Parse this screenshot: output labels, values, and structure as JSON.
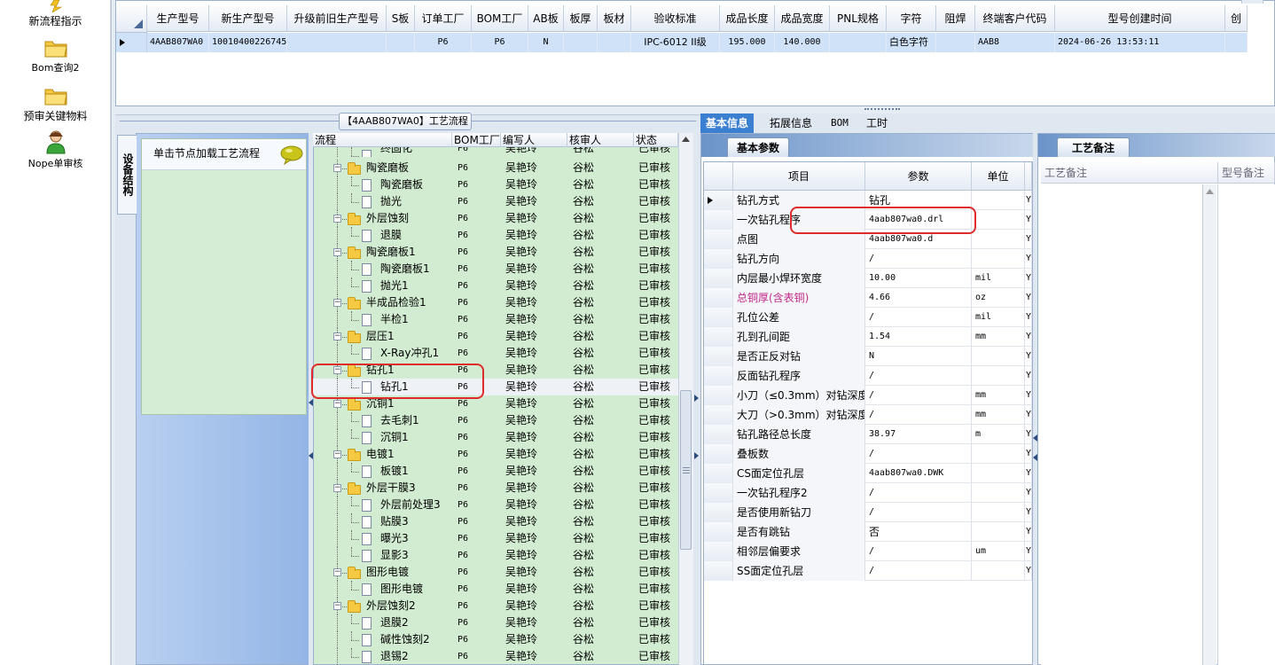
{
  "left_nav": {
    "items": [
      {
        "label": "新流程指示",
        "icon": "lightning-icon"
      },
      {
        "label": "Bom查询2",
        "icon": "folder-icon"
      },
      {
        "label": "预审关键物料",
        "icon": "folder-icon"
      },
      {
        "label": "Nope单审核",
        "icon": "user-icon"
      }
    ]
  },
  "top_grid": {
    "columns": [
      "生产型号",
      "新生产型号",
      "升级前旧生产型号",
      "S板",
      "订单工厂",
      "BOM工厂",
      "AB板",
      "板厚",
      "板材",
      "验收标准",
      "成品长度",
      "成品宽度",
      "PNL规格",
      "字符",
      "阻焊",
      "终端客户代码",
      "型号创建时间",
      "创"
    ],
    "row": [
      "4AAB807WA0",
      "10010400226745",
      "",
      "",
      "P6",
      "P6",
      "N",
      "",
      "",
      "IPC-6012 II级",
      "195.000",
      "140.000",
      "",
      "白色字符",
      "",
      "AAB8",
      "2024-06-26 13:53:11",
      ""
    ]
  },
  "flow": {
    "title": "【4AAB807WA0】工艺流程",
    "equipment_tab": "设备结构",
    "equipment_hint": "单击节点加载工艺流程",
    "tree_columns": [
      "流程",
      "BOM工厂",
      "编写人",
      "核审人",
      "状态"
    ],
    "tree_rows": [
      {
        "name": "终固化",
        "level": 2,
        "type": "doc",
        "bom": "P6",
        "writer": "吴艳玲",
        "reviewer": "谷松",
        "status": "已审核"
      },
      {
        "name": "陶瓷磨板",
        "level": 1,
        "type": "folder",
        "bom": "P6",
        "writer": "吴艳玲",
        "reviewer": "谷松",
        "status": "已审核"
      },
      {
        "name": "陶瓷磨板",
        "level": 2,
        "type": "doc",
        "bom": "P6",
        "writer": "吴艳玲",
        "reviewer": "谷松",
        "status": "已审核"
      },
      {
        "name": "抛光",
        "level": 2,
        "type": "doc",
        "bom": "P6",
        "writer": "吴艳玲",
        "reviewer": "谷松",
        "status": "已审核"
      },
      {
        "name": "外层蚀刻",
        "level": 1,
        "type": "folder",
        "bom": "P6",
        "writer": "吴艳玲",
        "reviewer": "谷松",
        "status": "已审核"
      },
      {
        "name": "退膜",
        "level": 2,
        "type": "doc",
        "bom": "P6",
        "writer": "吴艳玲",
        "reviewer": "谷松",
        "status": "已审核"
      },
      {
        "name": "陶瓷磨板1",
        "level": 1,
        "type": "folder",
        "bom": "P6",
        "writer": "吴艳玲",
        "reviewer": "谷松",
        "status": "已审核"
      },
      {
        "name": "陶瓷磨板1",
        "level": 2,
        "type": "doc",
        "bom": "P6",
        "writer": "吴艳玲",
        "reviewer": "谷松",
        "status": "已审核"
      },
      {
        "name": "抛光1",
        "level": 2,
        "type": "doc",
        "bom": "P6",
        "writer": "吴艳玲",
        "reviewer": "谷松",
        "status": "已审核"
      },
      {
        "name": "半成品检验1",
        "level": 1,
        "type": "folder",
        "bom": "P6",
        "writer": "吴艳玲",
        "reviewer": "谷松",
        "status": "已审核"
      },
      {
        "name": "半检1",
        "level": 2,
        "type": "doc",
        "bom": "P6",
        "writer": "吴艳玲",
        "reviewer": "谷松",
        "status": "已审核"
      },
      {
        "name": "层压1",
        "level": 1,
        "type": "folder",
        "bom": "P6",
        "writer": "吴艳玲",
        "reviewer": "谷松",
        "status": "已审核"
      },
      {
        "name": "X-Ray冲孔1",
        "level": 2,
        "type": "doc",
        "bom": "P6",
        "writer": "吴艳玲",
        "reviewer": "谷松",
        "status": "已审核"
      },
      {
        "name": "钻孔1",
        "level": 1,
        "type": "folder",
        "bom": "P6",
        "writer": "吴艳玲",
        "reviewer": "谷松",
        "status": "已审核"
      },
      {
        "name": "钻孔1",
        "level": 2,
        "type": "doc",
        "bom": "P6",
        "writer": "吴艳玲",
        "reviewer": "谷松",
        "status": "已审核",
        "selected": true
      },
      {
        "name": "沉铜1",
        "level": 1,
        "type": "folder",
        "bom": "P6",
        "writer": "吴艳玲",
        "reviewer": "谷松",
        "status": "已审核"
      },
      {
        "name": "去毛刺1",
        "level": 2,
        "type": "doc",
        "bom": "P6",
        "writer": "吴艳玲",
        "reviewer": "谷松",
        "status": "已审核"
      },
      {
        "name": "沉铜1",
        "level": 2,
        "type": "doc",
        "bom": "P6",
        "writer": "吴艳玲",
        "reviewer": "谷松",
        "status": "已审核"
      },
      {
        "name": "电镀1",
        "level": 1,
        "type": "folder",
        "bom": "P6",
        "writer": "吴艳玲",
        "reviewer": "谷松",
        "status": "已审核"
      },
      {
        "name": "板镀1",
        "level": 2,
        "type": "doc",
        "bom": "P6",
        "writer": "吴艳玲",
        "reviewer": "谷松",
        "status": "已审核"
      },
      {
        "name": "外层干膜3",
        "level": 1,
        "type": "folder",
        "bom": "P6",
        "writer": "吴艳玲",
        "reviewer": "谷松",
        "status": "已审核"
      },
      {
        "name": "外层前处理3",
        "level": 2,
        "type": "doc",
        "bom": "P6",
        "writer": "吴艳玲",
        "reviewer": "谷松",
        "status": "已审核"
      },
      {
        "name": "贴膜3",
        "level": 2,
        "type": "doc",
        "bom": "P6",
        "writer": "吴艳玲",
        "reviewer": "谷松",
        "status": "已审核"
      },
      {
        "name": "曝光3",
        "level": 2,
        "type": "doc",
        "bom": "P6",
        "writer": "吴艳玲",
        "reviewer": "谷松",
        "status": "已审核"
      },
      {
        "name": "显影3",
        "level": 2,
        "type": "doc",
        "bom": "P6",
        "writer": "吴艳玲",
        "reviewer": "谷松",
        "status": "已审核"
      },
      {
        "name": "图形电镀",
        "level": 1,
        "type": "folder",
        "bom": "P6",
        "writer": "吴艳玲",
        "reviewer": "谷松",
        "status": "已审核"
      },
      {
        "name": "图形电镀",
        "level": 2,
        "type": "doc",
        "bom": "P6",
        "writer": "吴艳玲",
        "reviewer": "谷松",
        "status": "已审核"
      },
      {
        "name": "外层蚀刻2",
        "level": 1,
        "type": "folder",
        "bom": "P6",
        "writer": "吴艳玲",
        "reviewer": "谷松",
        "status": "已审核"
      },
      {
        "name": "退膜2",
        "level": 2,
        "type": "doc",
        "bom": "P6",
        "writer": "吴艳玲",
        "reviewer": "谷松",
        "status": "已审核"
      },
      {
        "name": "碱性蚀刻2",
        "level": 2,
        "type": "doc",
        "bom": "P6",
        "writer": "吴艳玲",
        "reviewer": "谷松",
        "status": "已审核"
      },
      {
        "name": "退锡2",
        "level": 2,
        "type": "doc",
        "bom": "P6",
        "writer": "吴艳玲",
        "reviewer": "谷松",
        "status": "已审核"
      }
    ]
  },
  "right_tabs": [
    "基本信息",
    "拓展信息",
    "BOM",
    "工时"
  ],
  "basic": {
    "tab_label": "基本参数",
    "columns": [
      "项目",
      "参数",
      "单位"
    ],
    "rows": [
      {
        "name": "钻孔方式",
        "value": "钻孔",
        "unit": "",
        "extra": "Y",
        "current": true
      },
      {
        "name": "一次钻孔程序",
        "value": "4aab807wa0.drl",
        "unit": "",
        "extra": "Y"
      },
      {
        "name": "点图",
        "value": "4aab807wa0.d",
        "unit": "",
        "extra": "Y"
      },
      {
        "name": "钻孔方向",
        "value": "/",
        "unit": "",
        "extra": "Y"
      },
      {
        "name": "内层最小焊环宽度",
        "value": "10.00",
        "unit": "mil",
        "extra": "Y"
      },
      {
        "name": "总铜厚(含表铜)",
        "value": "4.66",
        "unit": "oz",
        "extra": "Y",
        "highlight": "#c0288a"
      },
      {
        "name": "孔位公差",
        "value": "/",
        "unit": "mil",
        "extra": "Y"
      },
      {
        "name": "孔到孔间距",
        "value": "1.54",
        "unit": "mm",
        "extra": "Y"
      },
      {
        "name": "是否正反对钻",
        "value": "N",
        "unit": "",
        "extra": "Y"
      },
      {
        "name": "反面钻孔程序",
        "value": "/",
        "unit": "",
        "extra": "Y"
      },
      {
        "name": "小刀（≤0.3mm）对钻深度",
        "value": "/",
        "unit": "mm",
        "extra": "Y"
      },
      {
        "name": "大刀（>0.3mm）对钻深度",
        "value": "/",
        "unit": "mm",
        "extra": "Y"
      },
      {
        "name": "钻孔路径总长度",
        "value": "38.97",
        "unit": "m",
        "extra": "Y"
      },
      {
        "name": "叠板数",
        "value": "/",
        "unit": "",
        "extra": "Y"
      },
      {
        "name": "CS面定位孔层",
        "value": "4aab807wa0.DWK",
        "unit": "",
        "extra": "Y"
      },
      {
        "name": "一次钻孔程序2",
        "value": "/",
        "unit": "",
        "extra": "Y"
      },
      {
        "name": "是否使用新钻刀",
        "value": "/",
        "unit": "",
        "extra": "Y"
      },
      {
        "name": "是否有跳钻",
        "value": "否",
        "unit": "",
        "extra": "Y"
      },
      {
        "name": "相邻层偏要求",
        "value": "/",
        "unit": "um",
        "extra": "Y"
      },
      {
        "name": "SS面定位孔层",
        "value": "/",
        "unit": "",
        "extra": "Y"
      }
    ]
  },
  "remark": {
    "tab_label": "工艺备注",
    "columns": [
      "工艺备注",
      "型号备注"
    ]
  },
  "colors": {
    "accent": "#3b7fd1",
    "tree_bg": "#d2ecd1",
    "selected_row": "#cfe2f8",
    "annotation": "#e02b2b"
  }
}
